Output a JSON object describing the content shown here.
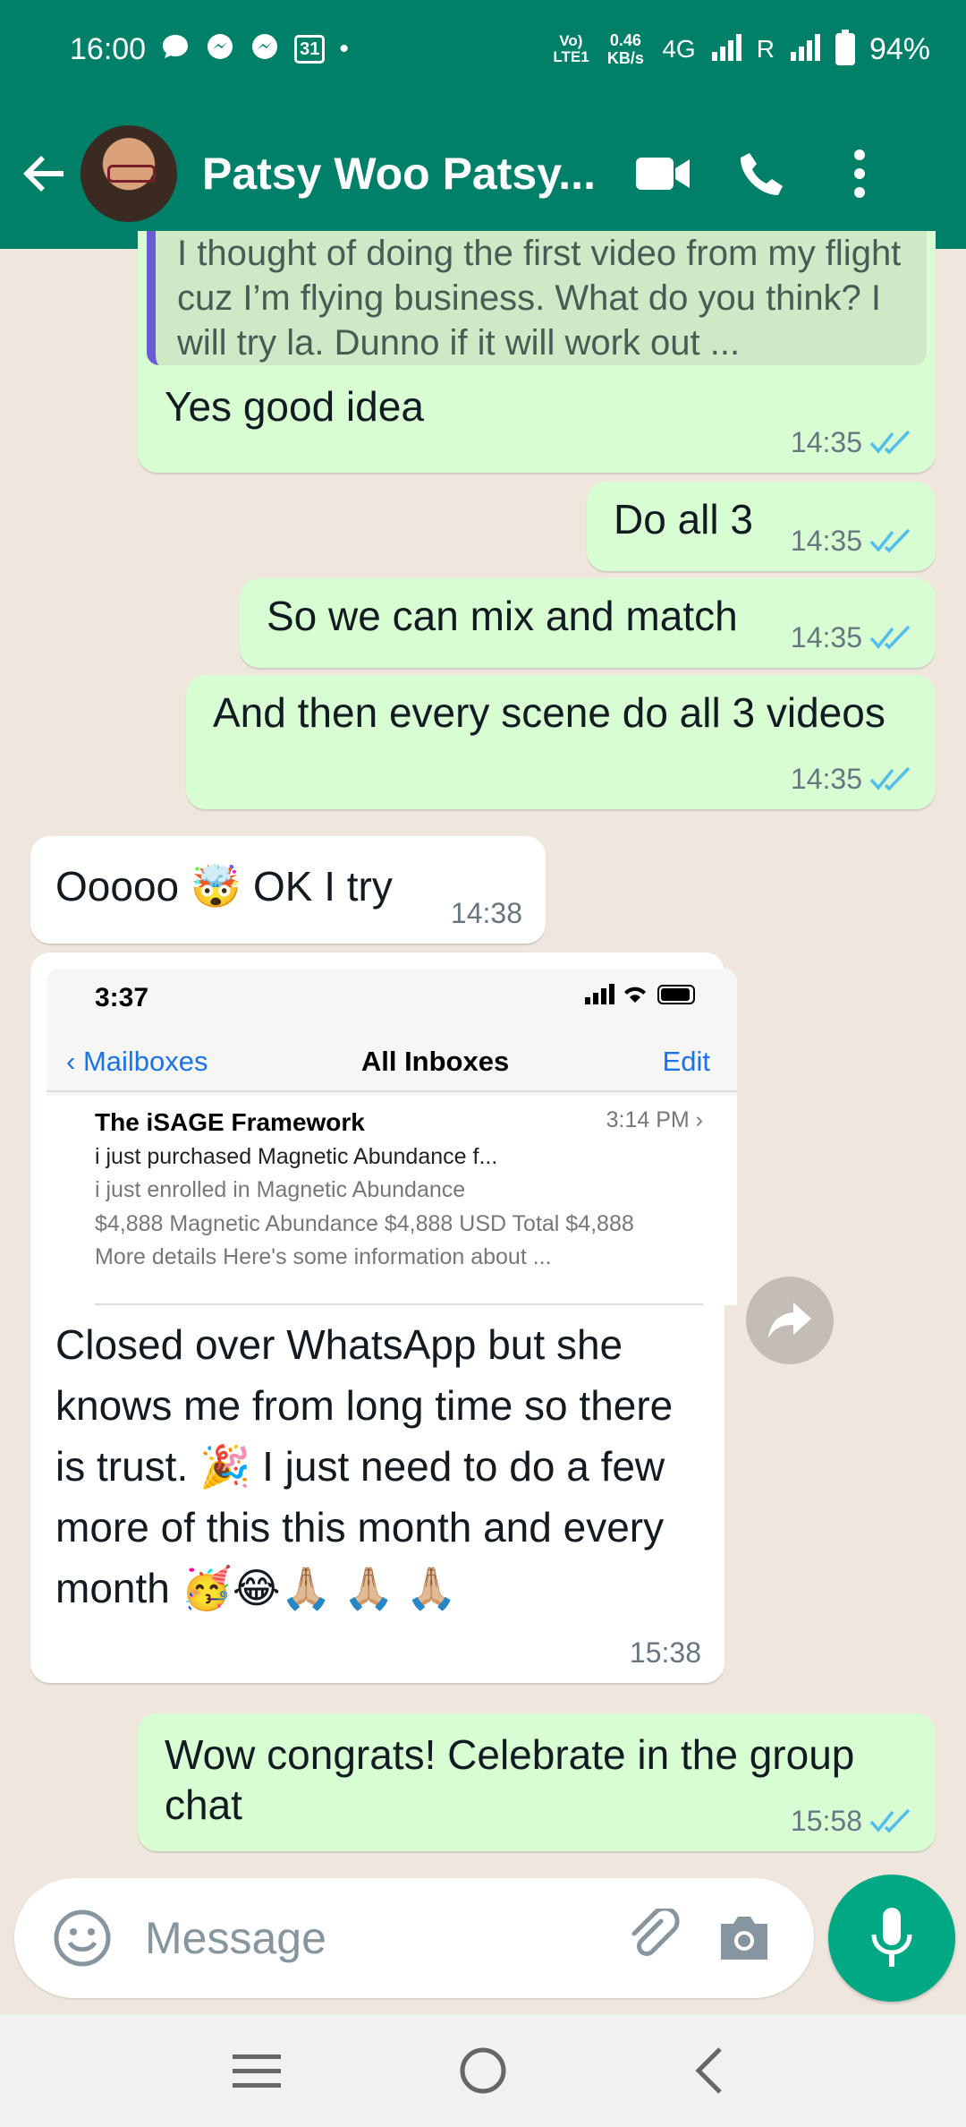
{
  "status_bar": {
    "time": "16:00",
    "calendar_day": "31",
    "volte": "VoLTE1",
    "speed": "0.46 KB/s",
    "network": "4G",
    "roaming": "R",
    "battery": "94%"
  },
  "header": {
    "contact_name": "Patsy Woo Patsy..."
  },
  "messages": [
    {
      "quote": "I thought of doing the first video from my flight cuz I’m flying business. What do you think? I will try la. Dunno if it will work out ...",
      "text": "Yes good idea",
      "time": "14:35"
    },
    {
      "text": "Do all 3",
      "time": "14:35"
    },
    {
      "text": "So we can mix and match",
      "time": "14:35"
    },
    {
      "text": "And then every scene do all 3 videos",
      "time": "14:35"
    },
    {
      "text_before": "Ooooo",
      "emoji": "🤯",
      "text_after": "OK I try",
      "time": "14:38"
    },
    {
      "text": "Closed over WhatsApp but she knows me from long time so there is trust. 🎉 I just need to do a few more of this this month and every month 🥳😂🙏🏼 🙏🏼 🙏🏼",
      "time": "15:38"
    },
    {
      "text": "Wow congrats! Celebrate in the group chat",
      "time": "15:58"
    }
  ],
  "screenshot": {
    "time": "3:37",
    "back_label": "Mailboxes",
    "title": "All Inboxes",
    "edit_label": "Edit",
    "sender": "The iSAGE Framework",
    "mail_time": "3:14 PM",
    "line1": "i just purchased Magnetic Abundance f...",
    "line2": "i just enrolled in Magnetic Abundance",
    "line3": "$4,888 Magnetic Abundance $4,888 USD Total $4,888",
    "line4": "More details Here's some information about ..."
  },
  "input": {
    "placeholder": "Message"
  },
  "colors": {
    "header": "#008069",
    "outgoing_bubble": "#d9fdd3",
    "incoming_bubble": "#ffffff",
    "read_tick": "#53bdeb",
    "mic": "#00a884"
  }
}
